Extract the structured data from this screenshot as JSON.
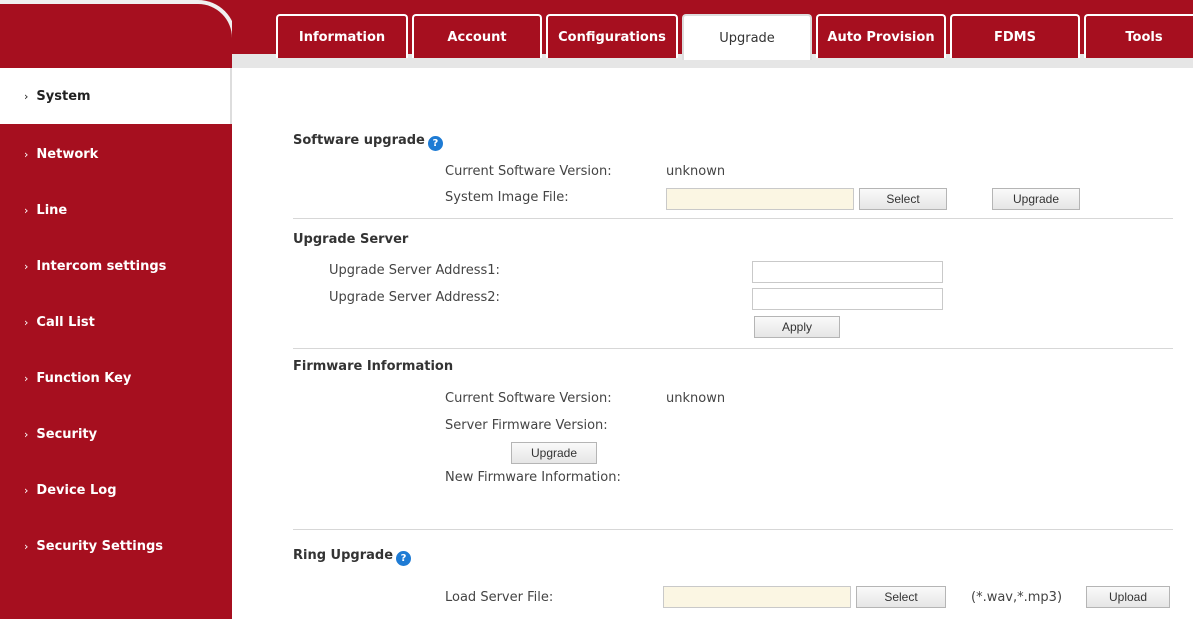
{
  "tabs": [
    "Information",
    "Account",
    "Configurations",
    "Upgrade",
    "Auto Provision",
    "FDMS",
    "Tools"
  ],
  "active_tab": "Upgrade",
  "sidebar": {
    "items": [
      {
        "label": "System"
      },
      {
        "label": "Network"
      },
      {
        "label": "Line"
      },
      {
        "label": "Intercom settings"
      },
      {
        "label": "Call List"
      },
      {
        "label": "Function Key"
      },
      {
        "label": "Security"
      },
      {
        "label": "Device Log"
      },
      {
        "label": "Security Settings"
      }
    ],
    "chevron": "›"
  },
  "software_upgrade": {
    "title": "Software upgrade",
    "current_version_label": "Current Software Version:",
    "current_version_value": "unknown",
    "image_file_label": "System Image File:",
    "select_label": "Select",
    "upgrade_label": "Upgrade"
  },
  "upgrade_server": {
    "title": "Upgrade Server",
    "address1_label": "Upgrade Server Address1:",
    "address2_label": "Upgrade Server Address2:",
    "address1_value": "",
    "address2_value": "",
    "apply_label": "Apply"
  },
  "firmware_info": {
    "title": "Firmware Information",
    "current_version_label": "Current Software Version:",
    "current_version_value": "unknown",
    "server_version_label": "Server Firmware Version:",
    "upgrade_label": "Upgrade",
    "new_info_label": "New Firmware Information:"
  },
  "ring_upgrade": {
    "title": "Ring Upgrade",
    "load_label": "Load Server File:",
    "select_label": "Select",
    "formats": "(*.wav,*.mp3)",
    "upload_label": "Upload"
  },
  "help_glyph": "?",
  "colors": {
    "brand": "#a60f1f",
    "help": "#1e7bd4"
  }
}
